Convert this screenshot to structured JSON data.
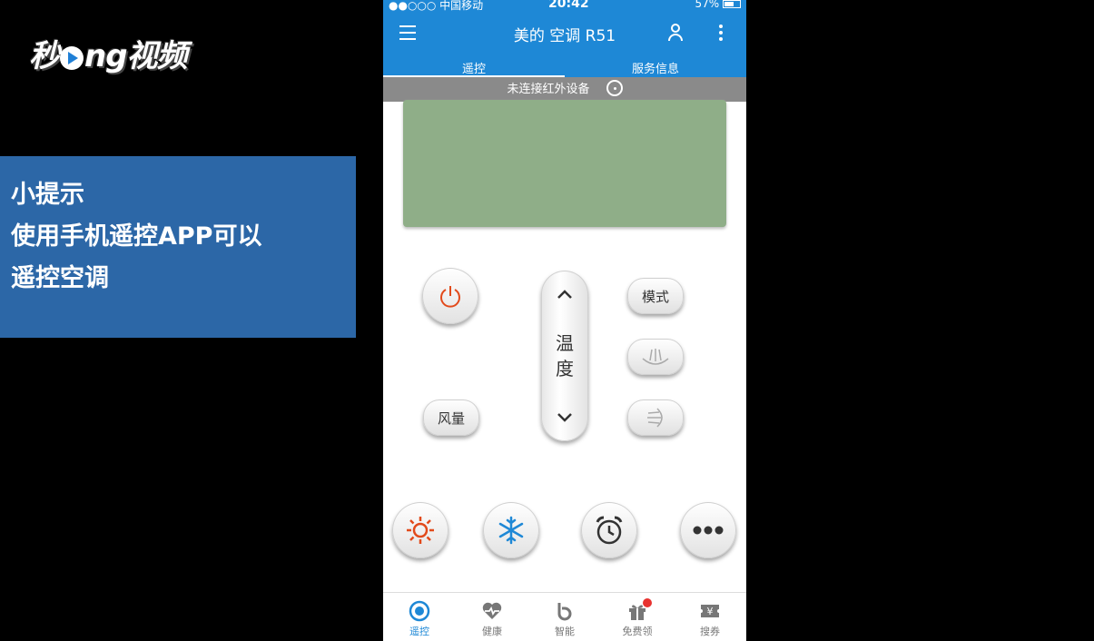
{
  "overlay": {
    "logo": [
      "秒",
      "d",
      "ng视频"
    ],
    "tip_lines": [
      "小提示",
      "使用手机遥控APP可以",
      "遥控空调"
    ]
  },
  "status_bar": {
    "carrier": "●●○○○ 中国移动",
    "time": "20:42",
    "battery": "57%"
  },
  "header": {
    "title": "美的 空调 R51"
  },
  "tabs": [
    {
      "label": "遥控",
      "active": true
    },
    {
      "label": "服务信息",
      "active": false
    }
  ],
  "ir_status": {
    "text": "未连接红外设备"
  },
  "remote": {
    "mode_label": "模式",
    "fan_label": "风量",
    "temp_label_1": "温",
    "temp_label_2": "度",
    "up_glyph": "⌃",
    "down_glyph": "⌄",
    "accent_power": "#e24a1b",
    "accent_heat": "#e24a1b",
    "accent_cool": "#1e88d6"
  },
  "bottom_nav": [
    {
      "label": "遥控",
      "icon": "remote-icon",
      "active": true
    },
    {
      "label": "健康",
      "icon": "heart-pulse-icon",
      "active": false
    },
    {
      "label": "智能",
      "icon": "smart-b-icon",
      "active": false
    },
    {
      "label": "免费领",
      "icon": "gift-icon",
      "active": false
    },
    {
      "label": "搜券",
      "icon": "coupon-icon",
      "active": false
    }
  ]
}
